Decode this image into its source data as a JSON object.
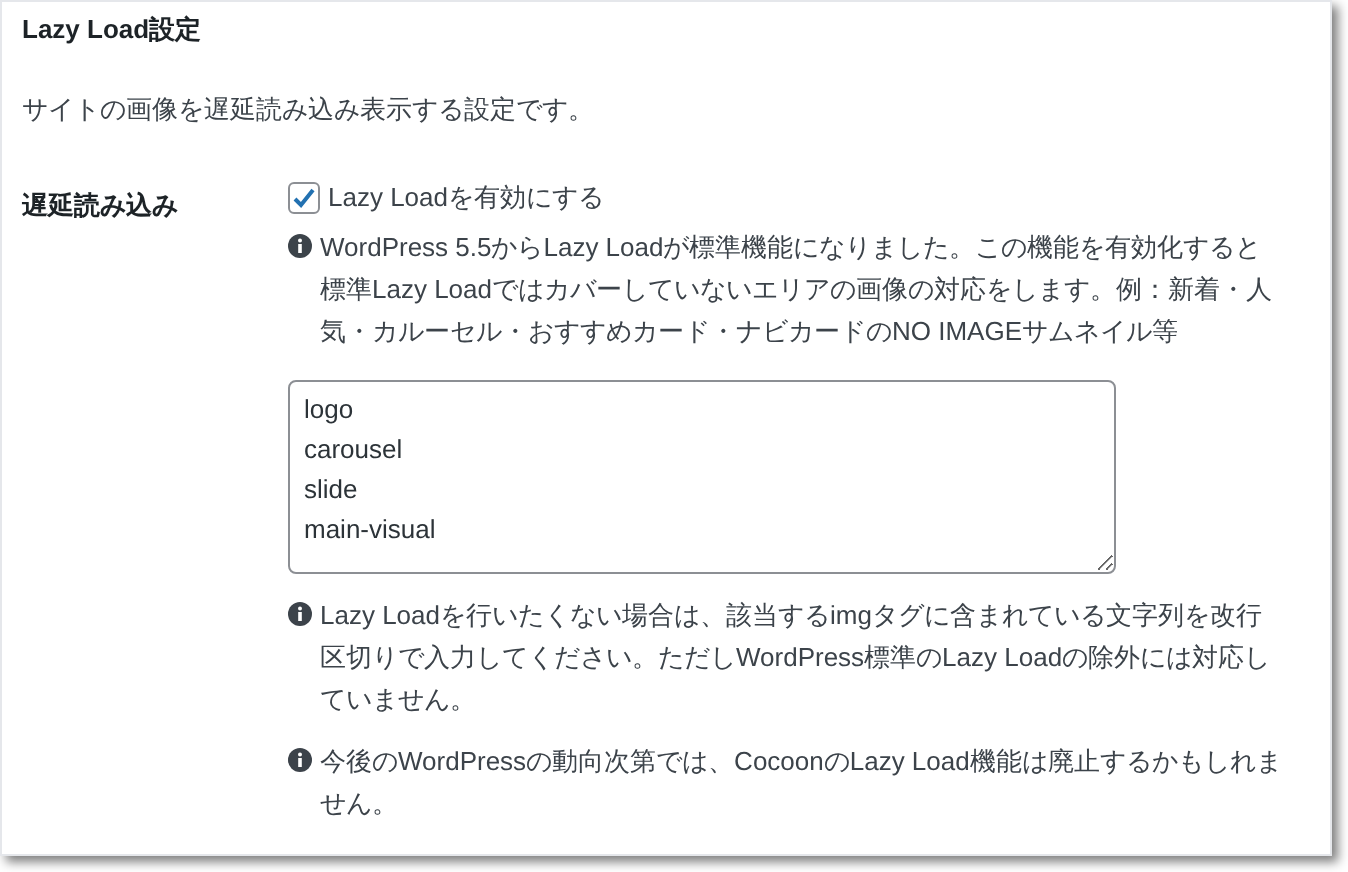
{
  "section_title": "Lazy Load設定",
  "description": "サイトの画像を遅延読み込み表示する設定です。",
  "setting": {
    "label": "遅延読み込み",
    "checkbox": {
      "label": "Lazy Loadを有効にする",
      "checked": true
    },
    "notes_before": [
      "WordPress 5.5からLazy Loadが標準機能になりました。この機能を有効化すると標準Lazy Loadではカバーしていないエリアの画像の対応をします。例：新着・人気・カルーセル・おすすめカード・ナビカードのNO IMAGEサムネイル等"
    ],
    "textarea": {
      "value": "logo\ncarousel\nslide\nmain-visual"
    },
    "notes_after": [
      "Lazy Loadを行いたくない場合は、該当するimgタグに含まれている文字列を改行区切りで入力してください。ただしWordPress標準のLazy Loadの除外には対応していません。",
      "今後のWordPressの動向次第では、CocoonのLazy Load機能は廃止するかもしれません。"
    ]
  }
}
